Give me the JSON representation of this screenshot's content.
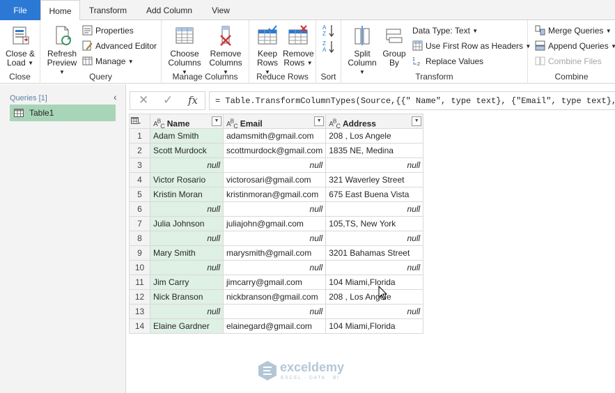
{
  "tabs": {
    "file": "File",
    "home": "Home",
    "transform": "Transform",
    "add_column": "Add Column",
    "view": "View"
  },
  "ribbon": {
    "close_group": {
      "label": "Close",
      "close_load": [
        "Close &",
        "Load"
      ]
    },
    "query_group": {
      "label": "Query",
      "refresh": [
        "Refresh",
        "Preview"
      ],
      "properties": "Properties",
      "advanced_editor": "Advanced Editor",
      "manage": "Manage"
    },
    "manage_columns_group": {
      "label": "Manage Columns",
      "choose": [
        "Choose",
        "Columns"
      ],
      "remove": [
        "Remove",
        "Columns"
      ]
    },
    "reduce_rows_group": {
      "label": "Reduce Rows",
      "keep": [
        "Keep",
        "Rows"
      ],
      "remove": [
        "Remove",
        "Rows"
      ]
    },
    "sort_group": {
      "label": "Sort"
    },
    "transform_group": {
      "label": "Transform",
      "split": [
        "Split",
        "Column"
      ],
      "group_by": [
        "Group",
        "By"
      ],
      "data_type": "Data Type: Text",
      "first_row": "Use First Row as Headers",
      "replace": "Replace Values"
    },
    "combine_group": {
      "label": "Combine",
      "merge": "Merge Queries",
      "append": "Append Queries",
      "combine_files": "Combine Files"
    }
  },
  "queries": {
    "title": "Queries [1]",
    "items": [
      "Table1"
    ]
  },
  "formula": "= Table.TransformColumnTypes(Source,{{\" Name\", type text}, {\"Email\", type text}, {\"Addr",
  "table": {
    "columns": [
      "Name",
      "Email",
      "Address"
    ],
    "type_label": "ABC",
    "null_text": "null",
    "rows": [
      {
        "n": "1",
        "name": "Adam Smith",
        "email": "adamsmith@gmail.com",
        "address": "208 , Los Angele"
      },
      {
        "n": "2",
        "name": "Scott Murdock",
        "email": "scottmurdock@gmail.com",
        "address": "1835  NE, Medina"
      },
      {
        "n": "3",
        "name": null,
        "email": null,
        "address": null
      },
      {
        "n": "4",
        "name": "Victor Rosario",
        "email": "victorosari@gmail.com",
        "address": "321 Waverley Street"
      },
      {
        "n": "5",
        "name": "Kristin Moran",
        "email": "kristinmoran@gmail.com",
        "address": "675 East Buena Vista"
      },
      {
        "n": "6",
        "name": null,
        "email": null,
        "address": null
      },
      {
        "n": "7",
        "name": "Julia Johnson",
        "email": "juliajohn@gmail.com",
        "address": "105,TS, New York"
      },
      {
        "n": "8",
        "name": null,
        "email": null,
        "address": null
      },
      {
        "n": "9",
        "name": "Mary Smith",
        "email": "marysmith@gmail.com",
        "address": "3201 Bahamas Street"
      },
      {
        "n": "10",
        "name": null,
        "email": null,
        "address": null
      },
      {
        "n": "11",
        "name": "Jim Carry",
        "email": "jimcarry@gmail.com",
        "address": "104 Miami,Florida"
      },
      {
        "n": "12",
        "name": "Nick Branson",
        "email": "nickbranson@gmail.com",
        "address": "208 , Los Angele"
      },
      {
        "n": "13",
        "name": null,
        "email": null,
        "address": null
      },
      {
        "n": "14",
        "name": "Elaine Gardner",
        "email": "elainegard@gmail.com",
        "address": "104 Miami,Florida"
      }
    ]
  },
  "watermark": {
    "name": "exceldemy",
    "tagline": "EXCEL · DATA · BI"
  },
  "colors": {
    "file_tab": "#2b79d4",
    "selected_query": "#a8d5b8",
    "name_column": "#dff0e5"
  }
}
